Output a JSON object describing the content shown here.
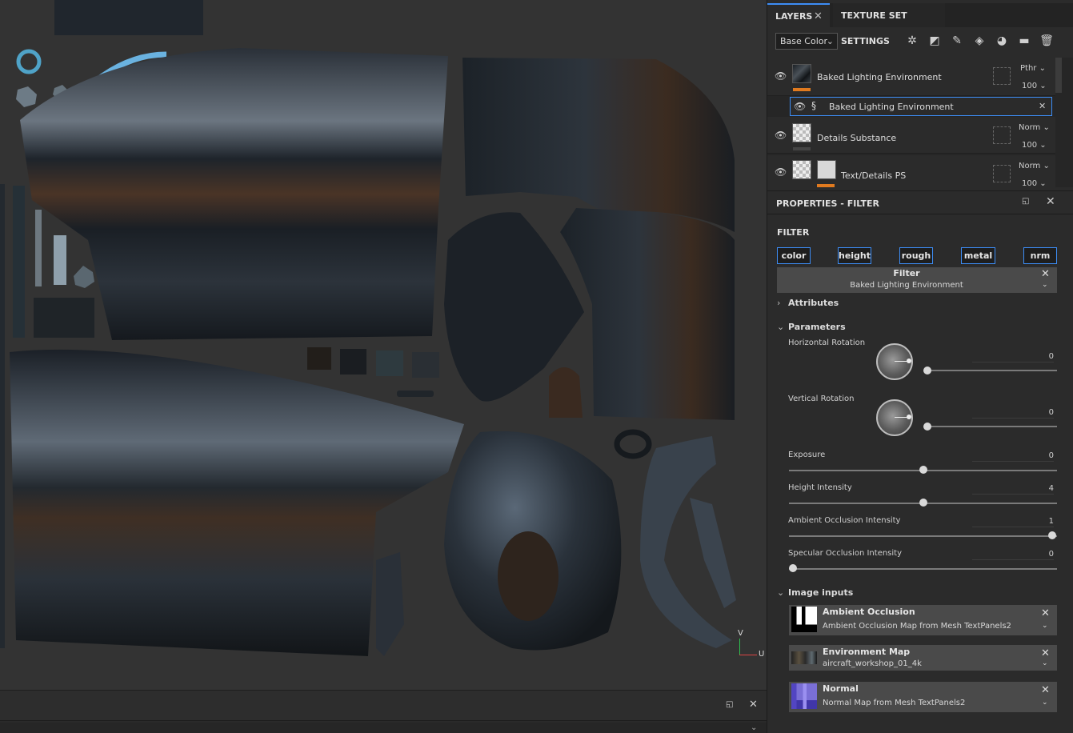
{
  "layers_panel": {
    "tab_layers": "LAYERS",
    "tab_texture_set_settings": "TEXTURE SET SETTINGS",
    "channel_select": "Base Color",
    "layers": [
      {
        "name": "Baked Lighting Environment",
        "blend": "Pthr",
        "opacity": "100"
      },
      {
        "name": "Baked Lighting Environment"
      },
      {
        "name": "Details Substance",
        "blend": "Norm",
        "opacity": "100"
      },
      {
        "name": "Text/Details PS",
        "blend": "Norm",
        "opacity": "100"
      }
    ]
  },
  "properties": {
    "title": "PROPERTIES - FILTER",
    "filter_label": "FILTER",
    "channels": [
      "color",
      "height",
      "rough",
      "metal",
      "nrm"
    ],
    "filter_box": {
      "title": "Filter",
      "subtitle": "Baked Lighting Environment"
    },
    "sections": {
      "attributes": "Attributes",
      "parameters": "Parameters",
      "image_inputs": "Image inputs"
    },
    "parameters": [
      {
        "label": "Horizontal Rotation",
        "value": "0",
        "fraction": 0.0
      },
      {
        "label": "Vertical Rotation",
        "value": "0",
        "fraction": 0.0
      },
      {
        "label": "Exposure",
        "value": "0",
        "fraction": 0.5
      },
      {
        "label": "Height Intensity",
        "value": "4",
        "fraction": 0.5
      },
      {
        "label": "Ambient Occlusion Intensity",
        "value": "1",
        "fraction": 1.0
      },
      {
        "label": "Specular Occlusion Intensity",
        "value": "0",
        "fraction": 0.0
      }
    ],
    "image_inputs": [
      {
        "title": "Ambient Occlusion",
        "subtitle": "Ambient Occlusion Map from Mesh TextPanels2"
      },
      {
        "title": "Environment Map",
        "subtitle": "aircraft_workshop_01_4k"
      },
      {
        "title": "Normal",
        "subtitle": "Normal Map from Mesh TextPanels2"
      }
    ]
  },
  "viewport": {
    "axis_v": "V",
    "axis_u": "U"
  },
  "icons": [
    "eye-icon",
    "close-icon",
    "magic-wand-icon",
    "mask-icon",
    "brush-icon",
    "fill-icon",
    "smart-material-icon",
    "folder-icon",
    "trash-icon",
    "filter-effect-icon",
    "chevron-down-icon",
    "chevron-right-icon",
    "float-panel-icon"
  ],
  "colors": {
    "accent": "#3d8df5",
    "orange_tab": "#e07a1f"
  }
}
